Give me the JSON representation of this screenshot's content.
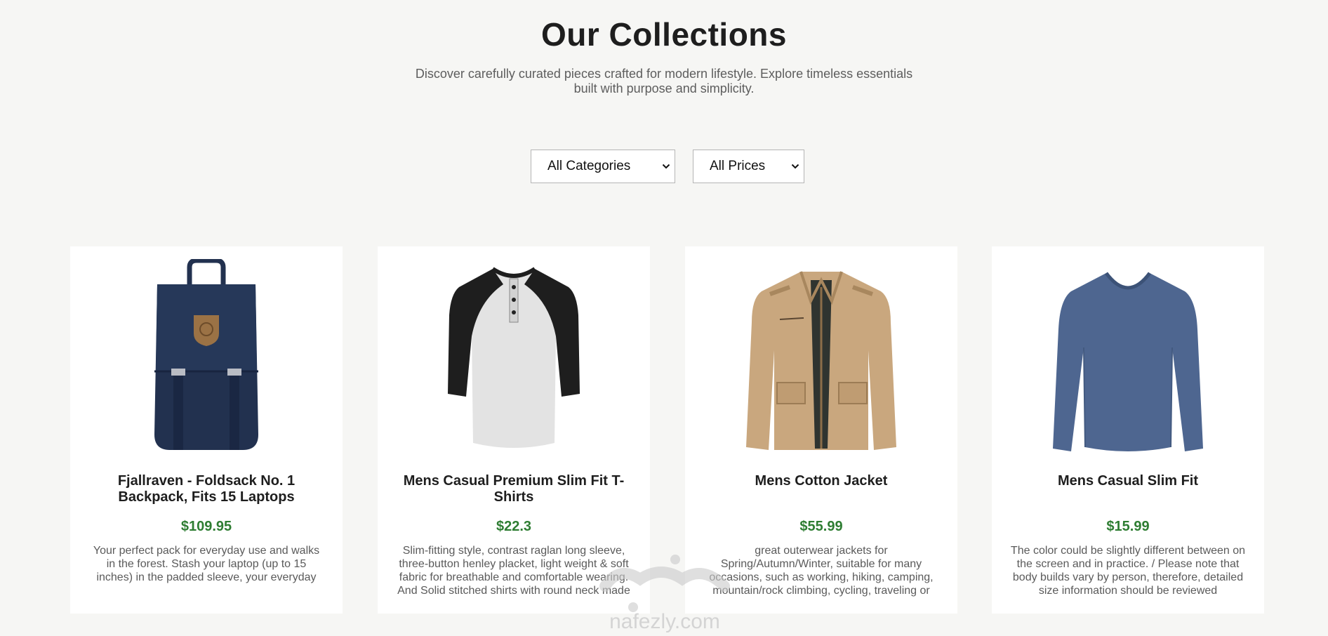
{
  "header": {
    "title": "Our Collections",
    "subtitle": "Discover carefully curated pieces crafted for modern lifestyle. Explore timeless essentials built with purpose and simplicity."
  },
  "filters": {
    "category": {
      "selected": "All Categories"
    },
    "price": {
      "selected": "All Prices"
    }
  },
  "products": [
    {
      "title": "Fjallraven - Foldsack No. 1 Backpack, Fits 15 Laptops",
      "price": "$109.95",
      "description": "Your perfect pack for everyday use and walks in the forest. Stash your laptop (up to 15 inches) in the padded sleeve, your everyday",
      "image_icon": "backpack-image"
    },
    {
      "title": "Mens Casual Premium Slim Fit T-Shirts",
      "price": "$22.3",
      "description": "Slim-fitting style, contrast raglan long sleeve, three-button henley placket, light weight & soft fabric for breathable and comfortable wearing. And Solid stitched shirts with round neck made",
      "image_icon": "raglan-shirt-image"
    },
    {
      "title": "Mens Cotton Jacket",
      "price": "$55.99",
      "description": "great outerwear jackets for Spring/Autumn/Winter, suitable for many occasions, such as working, hiking, camping, mountain/rock climbing, cycling, traveling or",
      "image_icon": "jacket-image"
    },
    {
      "title": "Mens Casual Slim Fit",
      "price": "$15.99",
      "description": "The color could be slightly different between on the screen and in practice. / Please note that body builds vary by person, therefore, detailed size information should be reviewed",
      "image_icon": "long-sleeve-shirt-image"
    }
  ],
  "watermark": {
    "brand": "nafezly.com",
    "icon": "nafezly-logo"
  },
  "colors": {
    "background": "#f6f6f4",
    "price": "#2e7d32",
    "card": "#ffffff",
    "backpack": "#22314f",
    "jacket": "#c9a77e",
    "blue_shirt": "#4e6690"
  }
}
